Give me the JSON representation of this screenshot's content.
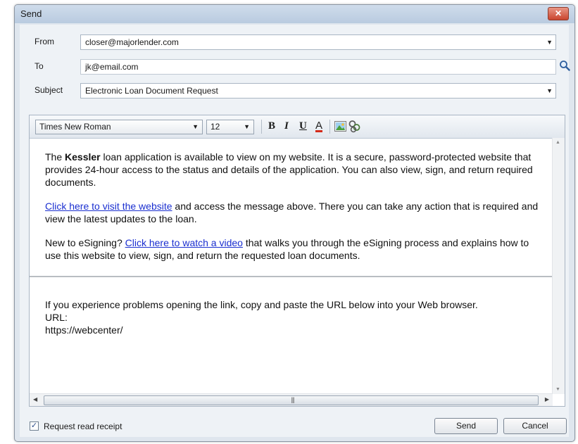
{
  "window": {
    "title": "Send"
  },
  "form": {
    "from": {
      "label": "From",
      "value": "closer@majorlender.com"
    },
    "to": {
      "label": "To",
      "value": "jk@email.com"
    },
    "subject": {
      "label": "Subject",
      "value": "Electronic Loan Document Request"
    }
  },
  "toolbar": {
    "font": "Times New Roman",
    "size": "12",
    "bold": "B",
    "italic": "I",
    "underline": "U",
    "color": "A"
  },
  "body": {
    "p1_pre": "The ",
    "p1_name": "Kessler",
    "p1_post": " loan application is available to view on my website. It is a secure, password-protected website that provides 24-hour access to the status and details of the application. You can also view, sign, and return required documents.",
    "p2_link": "Click here to visit the website",
    "p2_post": " and access the message above. There you can take any action that is required and view the latest updates to the loan.",
    "p3_pre": "New to eSigning? ",
    "p3_link": "Click here to watch a video",
    "p3_post": " that walks you through the eSigning process and explains how to use this website to view, sign, and return the requested loan documents.",
    "p4": "If you experience problems opening the link, copy and paste the URL below into your Web browser.",
    "url_label": "URL:",
    "url": "https://webcenter/"
  },
  "footer": {
    "read_receipt_label": "Request read receipt",
    "read_receipt_checked": true,
    "send_label": "Send",
    "cancel_label": "Cancel"
  },
  "colors": {
    "link": "#1a2fd0",
    "close_button": "#c9452e"
  }
}
